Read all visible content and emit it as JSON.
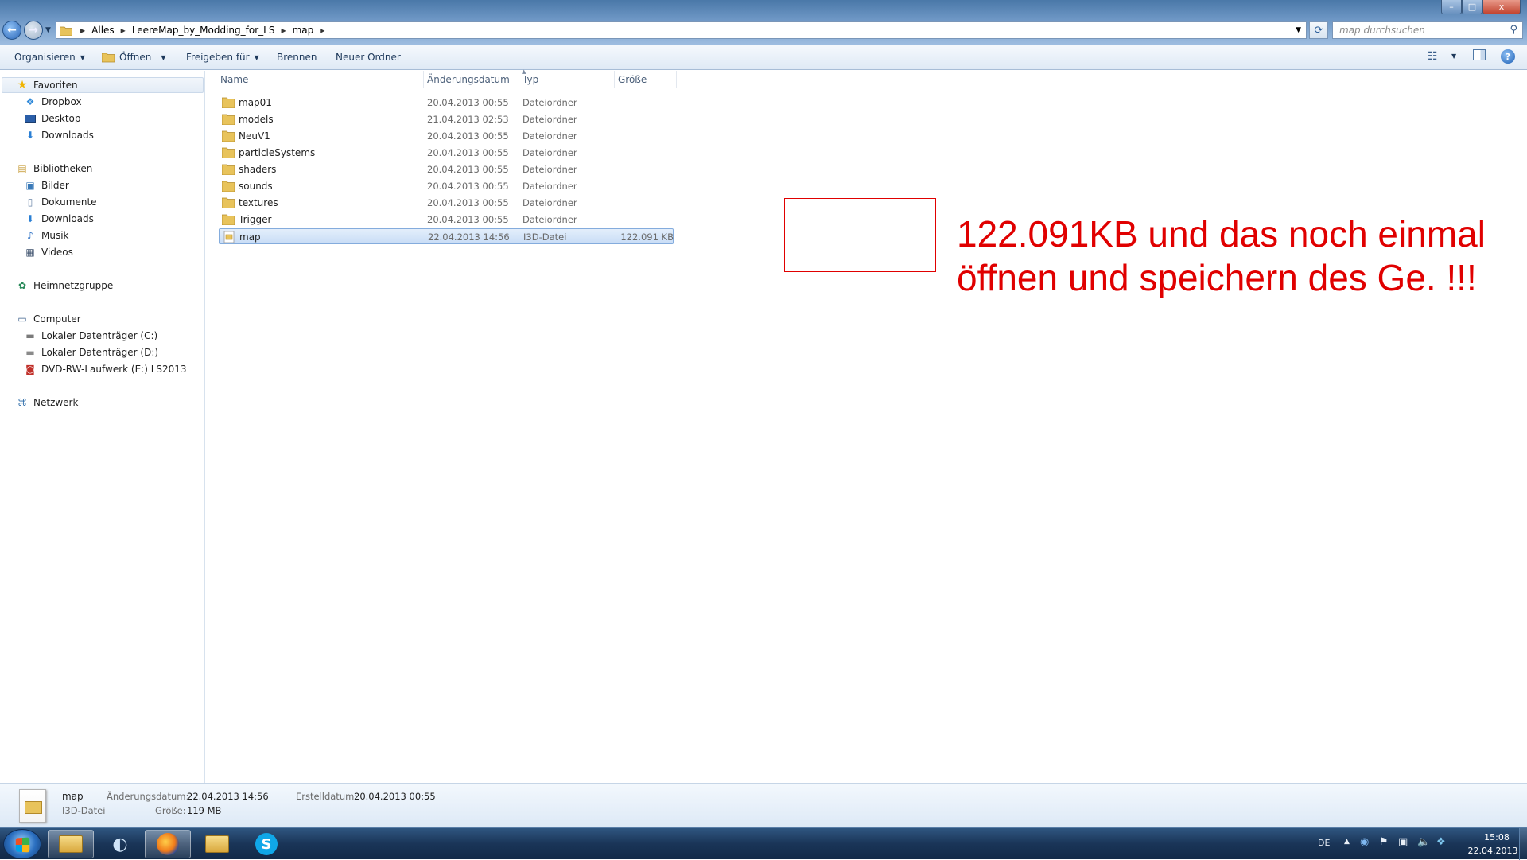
{
  "window": {
    "breadcrumbs": [
      "Alles",
      "LeereMap_by_Modding_for_LS",
      "map"
    ],
    "search_placeholder": "map durchsuchen",
    "caption_min": "–",
    "caption_max": "□",
    "caption_close": "x"
  },
  "toolbar": {
    "organize": "Organisieren",
    "open": "Öffnen",
    "share": "Freigeben für",
    "burn": "Brennen",
    "new_folder": "Neuer Ordner"
  },
  "nav": {
    "favorites": {
      "label": "Favoriten",
      "items": [
        "Dropbox",
        "Desktop",
        "Downloads"
      ]
    },
    "libraries": {
      "label": "Bibliotheken",
      "items": [
        "Bilder",
        "Dokumente",
        "Downloads",
        "Musik",
        "Videos"
      ]
    },
    "homegroup": "Heimnetzgruppe",
    "computer": {
      "label": "Computer",
      "items": [
        "Lokaler Datenträger (C:)",
        "Lokaler Datenträger (D:)",
        "DVD-RW-Laufwerk (E:) LS2013"
      ]
    },
    "network": "Netzwerk"
  },
  "columns": [
    "Name",
    "Änderungsdatum",
    "Typ",
    "Größe"
  ],
  "files": [
    {
      "name": "map01",
      "date": "20.04.2013 00:55",
      "type": "Dateiordner",
      "size": ""
    },
    {
      "name": "models",
      "date": "21.04.2013 02:53",
      "type": "Dateiordner",
      "size": ""
    },
    {
      "name": "NeuV1",
      "date": "20.04.2013 00:55",
      "type": "Dateiordner",
      "size": ""
    },
    {
      "name": "particleSystems",
      "date": "20.04.2013 00:55",
      "type": "Dateiordner",
      "size": ""
    },
    {
      "name": "shaders",
      "date": "20.04.2013 00:55",
      "type": "Dateiordner",
      "size": ""
    },
    {
      "name": "sounds",
      "date": "20.04.2013 00:55",
      "type": "Dateiordner",
      "size": ""
    },
    {
      "name": "textures",
      "date": "20.04.2013 00:55",
      "type": "Dateiordner",
      "size": ""
    },
    {
      "name": "Trigger",
      "date": "20.04.2013 00:55",
      "type": "Dateiordner",
      "size": ""
    },
    {
      "name": "map",
      "date": "22.04.2013 14:56",
      "type": "I3D-Datei",
      "size": "122.091 KB",
      "selected": true
    }
  ],
  "annotation": {
    "line1": "122.091KB und das noch einmal",
    "line2": "öffnen und speichern des Ge. !!!",
    "color": "#e00000"
  },
  "details": {
    "name": "map",
    "type": "I3D-Datei",
    "modified_label": "Änderungsdatum:",
    "modified_value": "22.04.2013 14:56",
    "size_label": "Größe:",
    "size_value": "119 MB",
    "created_label": "Erstelldatum:",
    "created_value": "20.04.2013 00:55"
  },
  "taskbar": {
    "language": "DE",
    "time": "15:08",
    "date": "22.04.2013",
    "pinned": [
      "explorer-icon",
      "media-center-icon",
      "firefox-icon",
      "explorer-folder-icon",
      "skype-icon"
    ]
  }
}
